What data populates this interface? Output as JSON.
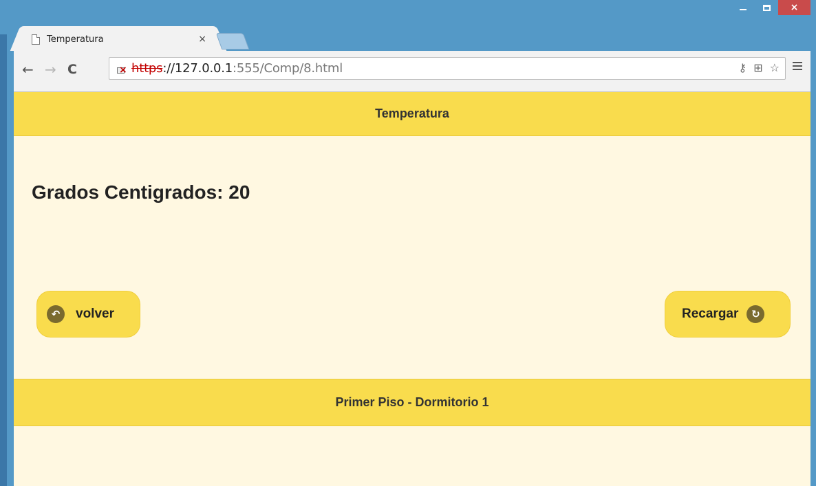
{
  "browser": {
    "tab_title": "Temperatura",
    "tab_close": "×",
    "url_protocol": "https",
    "url_host": "://127.0.0.1",
    "url_rest": ":555/Comp/8.html",
    "window_close": "×"
  },
  "page": {
    "header_title": "Temperatura",
    "reading_label": "Grados Centigrados: 20",
    "back_button_label": "volver",
    "reload_button_label": "Recargar",
    "footer_title": "Primer Piso - Dormitorio 1"
  },
  "icons": {
    "back": "back-circle-icon",
    "reload": "refresh-circle-icon"
  },
  "colors": {
    "bar": "#f9dc4d",
    "background": "#fff8e1",
    "icon_circle": "#7a6a2e"
  }
}
